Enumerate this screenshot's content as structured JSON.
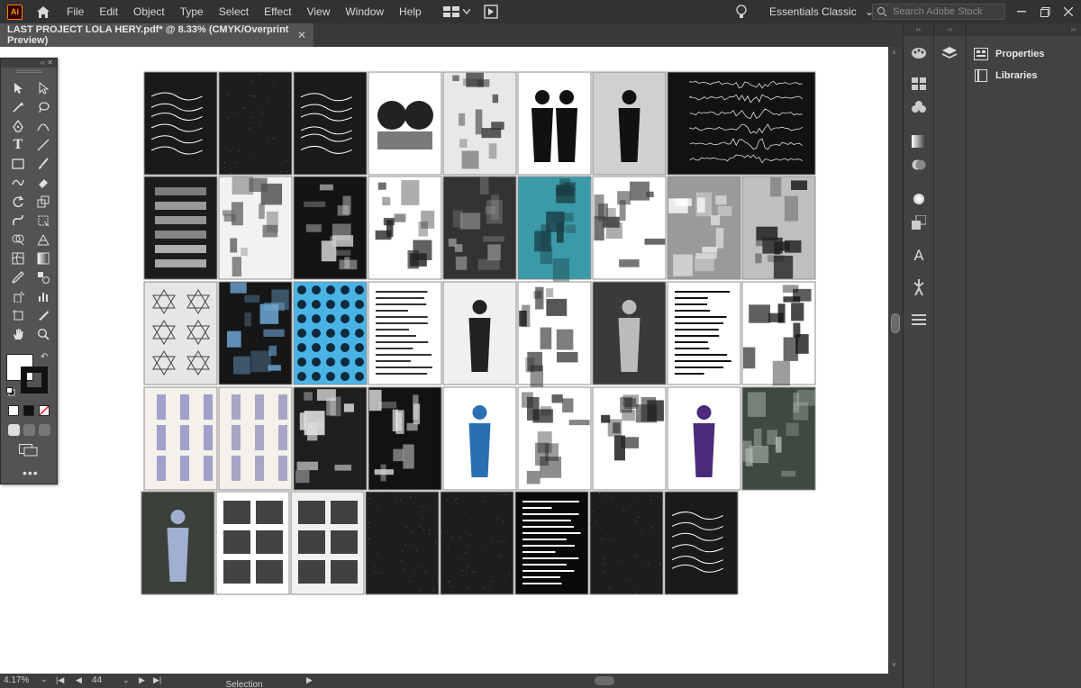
{
  "app": {
    "logo_text": "Ai"
  },
  "menu": [
    "File",
    "Edit",
    "Object",
    "Type",
    "Select",
    "Effect",
    "View",
    "Window",
    "Help"
  ],
  "workspace": {
    "label": "Essentials Classic"
  },
  "search": {
    "placeholder": "Search Adobe Stock"
  },
  "document": {
    "tab_title": "LAST PROJECT LOLA HERY.pdf* @ 8.33% (CMYK/Overprint Preview)"
  },
  "panels": {
    "properties_label": "Properties",
    "libraries_label": "Libraries"
  },
  "status": {
    "zoom": "4.17%",
    "artboard_number": "44",
    "current_tool": "Selection"
  },
  "colors": {
    "ui_dark": "#323232",
    "ui_mid": "#535353",
    "accent_teal": "#3b9aa8",
    "accent_blue": "#49b3e6",
    "illustrator_orange": "#ff9a00"
  },
  "artboard_thumbnails": [
    {
      "row": 1,
      "items": [
        {
          "bg": "#1a1a1a",
          "fg": "#ffffff",
          "style": "script"
        },
        {
          "bg": "#1d1d1d",
          "fg": "#555555",
          "style": "noise"
        },
        {
          "bg": "#1a1a1a",
          "fg": "#ffffff",
          "style": "script"
        },
        {
          "bg": "#ffffff",
          "fg": "#222222",
          "style": "photo"
        },
        {
          "bg": "#e8e8e8",
          "fg": "#333333",
          "style": "collage"
        },
        {
          "bg": "#ffffff",
          "fg": "#111111",
          "style": "figures"
        },
        {
          "bg": "#d0d0d0",
          "fg": "#111111",
          "style": "figure"
        },
        {
          "bg": "#121212",
          "fg": "#e0e0e0",
          "style": "waves"
        }
      ]
    },
    {
      "row": 2,
      "items": [
        {
          "bg": "#1c1c1c",
          "fg": "#d0d0d0",
          "style": "bars"
        },
        {
          "bg": "#f2f2f2",
          "fg": "#555555",
          "style": "collage"
        },
        {
          "bg": "#141414",
          "fg": "#cccccc",
          "style": "collage"
        },
        {
          "bg": "#ffffff",
          "fg": "#222222",
          "style": "collage"
        },
        {
          "bg": "#333333",
          "fg": "#999999",
          "style": "texture"
        },
        {
          "bg": "#3b9aa8",
          "fg": "#1a3e44",
          "style": "texture"
        },
        {
          "bg": "#ffffff",
          "fg": "#444444",
          "style": "collage"
        },
        {
          "bg": "#9a9a9a",
          "fg": "#ffffff",
          "style": "texture"
        },
        {
          "bg": "#bfbfbf",
          "fg": "#222222",
          "style": "texture"
        }
      ]
    },
    {
      "row": 3,
      "items": [
        {
          "bg": "#e6e6e6",
          "fg": "#444444",
          "style": "diagram"
        },
        {
          "bg": "#161616",
          "fg": "#6fa8d6",
          "style": "collage"
        },
        {
          "bg": "#49b3e6",
          "fg": "#0e2a3c",
          "style": "pattern"
        },
        {
          "bg": "#ffffff",
          "fg": "#333333",
          "style": "text"
        },
        {
          "bg": "#f0f0f0",
          "fg": "#222222",
          "style": "figure"
        },
        {
          "bg": "#ffffff",
          "fg": "#222222",
          "style": "collage"
        },
        {
          "bg": "#3a3a3a",
          "fg": "#bbbbbb",
          "style": "figure"
        },
        {
          "bg": "#ffffff",
          "fg": "#111111",
          "style": "text"
        },
        {
          "bg": "#ffffff",
          "fg": "#111111",
          "style": "texture"
        }
      ]
    },
    {
      "row": 4,
      "items": [
        {
          "bg": "#f4f0ea",
          "fg": "#5a5fb0",
          "style": "sketch"
        },
        {
          "bg": "#f4f0ea",
          "fg": "#6a6aa8",
          "style": "sketch"
        },
        {
          "bg": "#1e1e1e",
          "fg": "#e0e0e0",
          "style": "texture"
        },
        {
          "bg": "#121212",
          "fg": "#dddddd",
          "style": "texture"
        },
        {
          "bg": "#ffffff",
          "fg": "#2b6fb3",
          "style": "figure"
        },
        {
          "bg": "#ffffff",
          "fg": "#222222",
          "style": "texture"
        },
        {
          "bg": "#ffffff",
          "fg": "#222222",
          "style": "texture"
        },
        {
          "bg": "#ffffff",
          "fg": "#4a2a7a",
          "style": "figure"
        },
        {
          "bg": "#3c4a40",
          "fg": "#b0bab0",
          "style": "texture"
        }
      ]
    },
    {
      "row": 5,
      "items": [
        {
          "bg": "#3a3f3a",
          "fg": "#9fb0d0",
          "style": "figure"
        },
        {
          "bg": "#ffffff",
          "fg": "#222222",
          "style": "frames"
        },
        {
          "bg": "#f0f0f0",
          "fg": "#222222",
          "style": "frames"
        },
        {
          "bg": "#1d1d1d",
          "fg": "#555555",
          "style": "noise"
        },
        {
          "bg": "#1d1d1d",
          "fg": "#555555",
          "style": "noise"
        },
        {
          "bg": "#0a0a0a",
          "fg": "#ffffff",
          "style": "text"
        },
        {
          "bg": "#1d1d1d",
          "fg": "#555555",
          "style": "noise"
        },
        {
          "bg": "#1a1a1a",
          "fg": "#ffffff",
          "style": "script"
        }
      ]
    }
  ]
}
